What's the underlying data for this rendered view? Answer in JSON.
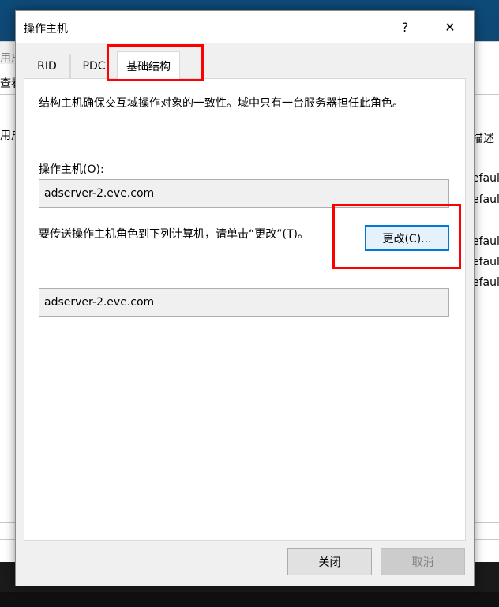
{
  "background_window": {
    "fragments": {
      "users_top": "用户",
      "view": "查看",
      "users_col": "用户",
      "description_col": "描述",
      "default_1": "efaul",
      "default_2": "efaul",
      "default_3": "efaul",
      "default_4": "efaul",
      "default_5": "efaul"
    }
  },
  "dialog": {
    "title": "操作主机",
    "help_glyph": "?",
    "close_glyph": "✕",
    "tabs": [
      {
        "label": "RID",
        "selected": false
      },
      {
        "label": "PDC",
        "selected": false
      },
      {
        "label": "基础结构",
        "selected": true
      }
    ],
    "panel": {
      "description": "结构主机确保交互域操作对象的一致性。域中只有一台服务器担任此角色。",
      "owner_label": "操作主机(O):",
      "owner_value": "adserver-2.eve.com",
      "transfer_text": "要传送操作主机角色到下列计算机，请单击“更改”(T)。",
      "change_button": "更改(C)...",
      "target_value": "adserver-2.eve.com"
    },
    "footer": {
      "close_button": "关闭",
      "cancel_button": "取消"
    }
  },
  "colors": {
    "highlight": "#ff0000",
    "accent_border": "#0078d7",
    "dialog_bg": "#f0f0f0"
  }
}
